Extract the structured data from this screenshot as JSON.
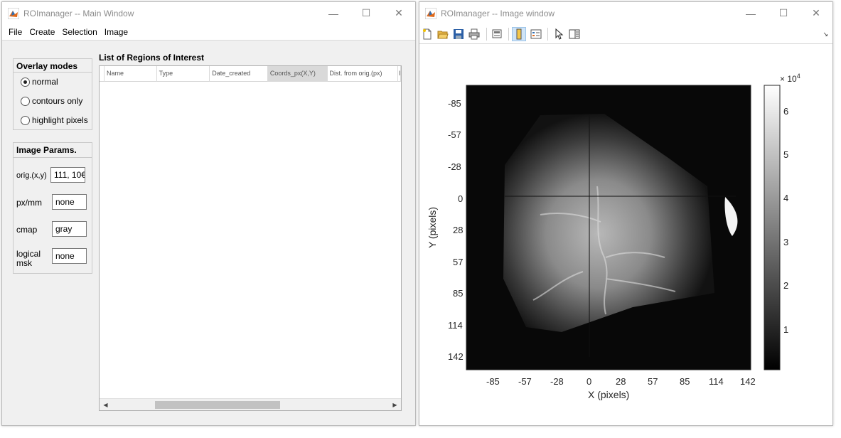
{
  "main_window": {
    "title": "ROImanager -- Main Window",
    "menu": [
      "File",
      "Create",
      "Selection",
      "Image"
    ],
    "overlay_panel": {
      "title": "Overlay modes",
      "options": [
        {
          "label": "normal",
          "checked": true
        },
        {
          "label": "contours only",
          "checked": false
        },
        {
          "label": "highlight pixels",
          "checked": false
        }
      ]
    },
    "params_panel": {
      "title": "Image Params.",
      "orig_label": "orig.(x,y)",
      "orig_value": "111, 10€",
      "pxmm_label": "px/mm",
      "pxmm_value": "none",
      "cmap_label": "cmap",
      "cmap_value": "gray",
      "mask_label_1": "logical",
      "mask_label_2": "msk",
      "mask_value": "none"
    },
    "roi_list": {
      "title": "List of Regions of Interest",
      "columns": [
        "Name",
        "Type",
        "Date_created",
        "Coords_px(X,Y)",
        "Dist. from orig.(px)",
        "I"
      ],
      "selected_column": "Coords_px(X,Y)"
    }
  },
  "image_window": {
    "title": "ROImanager -- Image window",
    "toolbar_icons": [
      "new-file-icon",
      "open-folder-icon",
      "save-icon",
      "print-icon",
      "print-preview-icon",
      "colorbar-icon",
      "legend-icon",
      "pointer-icon",
      "property-inspector-icon"
    ],
    "x_axis_label": "X (pixels)",
    "y_axis_label": "Y (pixels)",
    "x_ticks": [
      "-85",
      "-57",
      "-28",
      "0",
      "28",
      "57",
      "85",
      "114",
      "142"
    ],
    "y_ticks": [
      "-85",
      "-57",
      "-28",
      "0",
      "28",
      "57",
      "85",
      "114",
      "142"
    ],
    "colorbar_ticks": [
      "1",
      "2",
      "3",
      "4",
      "5",
      "6"
    ],
    "colorbar_multiplier_base": "× 10",
    "colorbar_multiplier_exp": "4"
  },
  "colors": {
    "window_bg": "#f0f0f0",
    "title_text": "#8c8c8c",
    "selected_header": "#d9d9d9",
    "active_toolbar": "#cfe4f7"
  }
}
